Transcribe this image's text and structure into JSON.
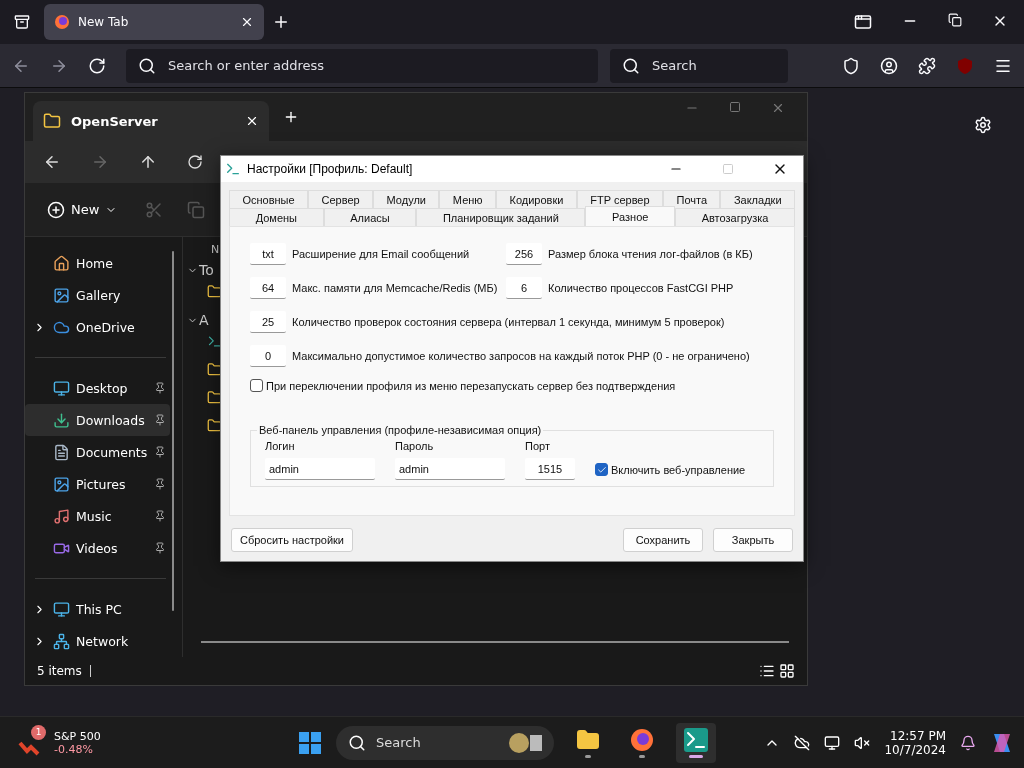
{
  "browser": {
    "tabs": [
      {
        "label": "New Tab",
        "selected": true
      }
    ],
    "address": {
      "placeholder": "Search or enter address"
    },
    "search": {
      "placeholder": "Search"
    }
  },
  "explorer": {
    "tab": {
      "label": "OpenServer"
    },
    "new_button": {
      "label": "New"
    },
    "sidebar": {
      "groups": [
        [
          {
            "label": "Home",
            "selected": false,
            "pinned": false,
            "expandable": false
          },
          {
            "label": "Gallery",
            "selected": false,
            "pinned": false,
            "expandable": false
          },
          {
            "label": "OneDrive",
            "selected": false,
            "pinned": false,
            "expandable": true
          }
        ],
        [
          {
            "label": "Desktop",
            "selected": false,
            "pinned": true,
            "expandable": false
          },
          {
            "label": "Downloads",
            "selected": true,
            "pinned": true,
            "expandable": false
          },
          {
            "label": "Documents",
            "selected": false,
            "pinned": true,
            "expandable": false
          },
          {
            "label": "Pictures",
            "selected": false,
            "pinned": true,
            "expandable": false
          },
          {
            "label": "Music",
            "selected": false,
            "pinned": true,
            "expandable": false
          },
          {
            "label": "Videos",
            "selected": false,
            "pinned": true,
            "expandable": false
          }
        ],
        [
          {
            "label": "This PC",
            "selected": false,
            "pinned": false,
            "expandable": true
          },
          {
            "label": "Network",
            "selected": false,
            "pinned": false,
            "expandable": true
          }
        ]
      ]
    },
    "column_1": "N",
    "groups": [
      {
        "label": "To",
        "expanded": true
      },
      {
        "label": "A",
        "expanded": true
      }
    ],
    "status_bar": "5 items"
  },
  "dialog": {
    "title": "Настройки [Профиль: Default]",
    "tab_rows": [
      [
        {
          "label": "Основные",
          "selected": false
        },
        {
          "label": "Сервер",
          "selected": false
        },
        {
          "label": "Модули",
          "selected": false
        },
        {
          "label": "Меню",
          "selected": false
        },
        {
          "label": "Кодировки",
          "selected": false
        },
        {
          "label": "FTP сервер",
          "selected": false
        },
        {
          "label": "Почта",
          "selected": false
        },
        {
          "label": "Закладки",
          "selected": false
        }
      ],
      [
        {
          "label": "Домены",
          "selected": false
        },
        {
          "label": "Алиасы",
          "selected": false
        },
        {
          "label": "Планировщик заданий",
          "selected": false
        },
        {
          "label": "Разное",
          "selected": true
        },
        {
          "label": "Автозагрузка",
          "selected": false
        }
      ]
    ],
    "setting_rows": [
      [
        {
          "value": "txt",
          "label": "Расширение для Email сообщений"
        },
        {
          "value": "256",
          "label": "Размер блока чтения лог-файлов (в КБ)"
        }
      ],
      [
        {
          "value": "64",
          "label": "Макс. памяти для Memcache/Redis (МБ)"
        },
        {
          "value": "6",
          "label": "Количество процессов FastCGI PHP"
        }
      ],
      [
        {
          "value": "25",
          "label": "Количество проверок состояния сервера (интервал 1 секунда, минимум 5 проверок)"
        }
      ],
      [
        {
          "value": "0",
          "label": "Максимально допустимое количество запросов на каждый поток PHP (0 - не ограничено)"
        }
      ]
    ],
    "restart_option": {
      "label": "При переключении профиля из меню перезапускать сервер без подтверждения",
      "checked": false
    },
    "web_panel": {
      "title": "Веб-панель управления (профиле-независимая опция)",
      "fields": [
        {
          "label": "Логин",
          "value": "admin"
        },
        {
          "label": "Пароль",
          "value": "admin"
        },
        {
          "label": "Порт",
          "value": "1515"
        }
      ],
      "enable": {
        "label": "Включить веб-управление",
        "checked": true
      }
    },
    "buttons": [
      {
        "label": "Сбросить настройки",
        "kind": "left"
      },
      {
        "label": "Сохранить",
        "kind": "right"
      },
      {
        "label": "Закрыть",
        "kind": "right"
      }
    ]
  },
  "taskbar": {
    "widget": {
      "badge": "1",
      "title": "S&P 500",
      "change": "-0.48%"
    },
    "search": {
      "placeholder": "Search"
    },
    "apps": [
      {
        "active": false,
        "running": true
      },
      {
        "active": false,
        "running": true
      },
      {
        "active": true,
        "running": true
      }
    ],
    "time": "12:57 PM",
    "date": "10/7/2024"
  }
}
